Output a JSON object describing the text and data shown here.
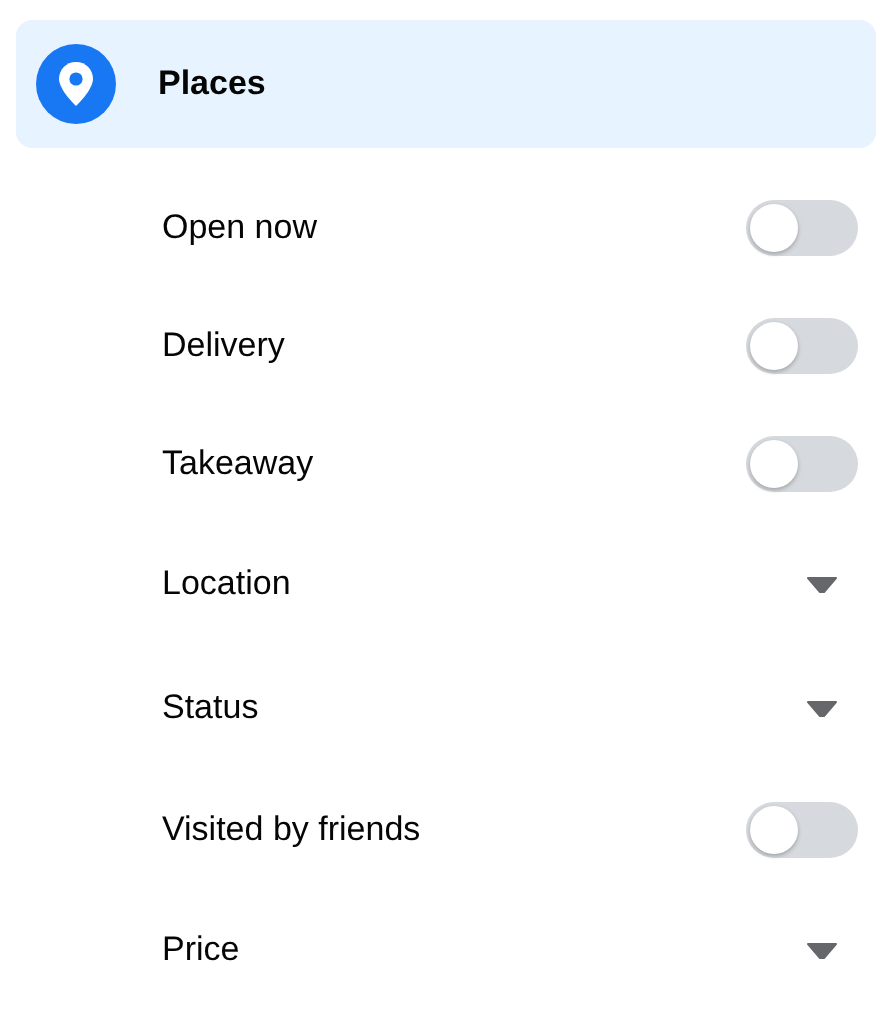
{
  "header": {
    "title": "Places"
  },
  "filters": [
    {
      "kind": "toggle",
      "label": "Open now",
      "on": false
    },
    {
      "kind": "toggle",
      "label": "Delivery",
      "on": false
    },
    {
      "kind": "toggle",
      "label": "Takeaway",
      "on": false
    },
    {
      "kind": "dropdown",
      "label": "Location"
    },
    {
      "kind": "dropdown",
      "label": "Status"
    },
    {
      "kind": "toggle",
      "label": "Visited by friends",
      "on": false
    },
    {
      "kind": "dropdown",
      "label": "Price"
    }
  ]
}
